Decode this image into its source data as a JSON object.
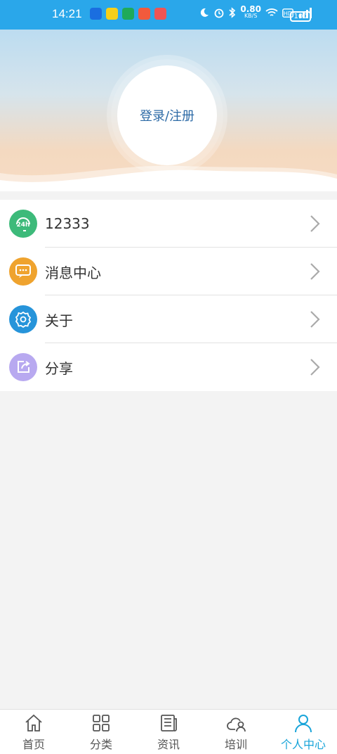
{
  "status_bar": {
    "time": "14:21",
    "network_speed": "0.80",
    "network_unit": "KB/S",
    "battery": "100",
    "app_icon_colors": [
      "#1a6ee0",
      "#f6cf19",
      "#1faa59",
      "#f25a3c",
      "#f05454"
    ]
  },
  "profile": {
    "login_label": "登录/注册"
  },
  "menu": {
    "items": [
      {
        "label": "12333",
        "icon": "24h-support-icon",
        "color": "#3dba7a"
      },
      {
        "label": "消息中心",
        "icon": "message-icon",
        "color": "#efa32e"
      },
      {
        "label": "关于",
        "icon": "gear-icon",
        "color": "#2694da"
      },
      {
        "label": "分享",
        "icon": "share-icon",
        "color": "#b8a9f0"
      }
    ]
  },
  "tabbar": {
    "tabs": [
      {
        "label": "首页",
        "icon": "home-icon"
      },
      {
        "label": "分类",
        "icon": "grid-icon"
      },
      {
        "label": "资讯",
        "icon": "news-icon"
      },
      {
        "label": "培训",
        "icon": "cloud-user-icon"
      },
      {
        "label": "个人中心",
        "icon": "person-icon",
        "active": true
      }
    ],
    "active_color": "#18a4d9"
  }
}
